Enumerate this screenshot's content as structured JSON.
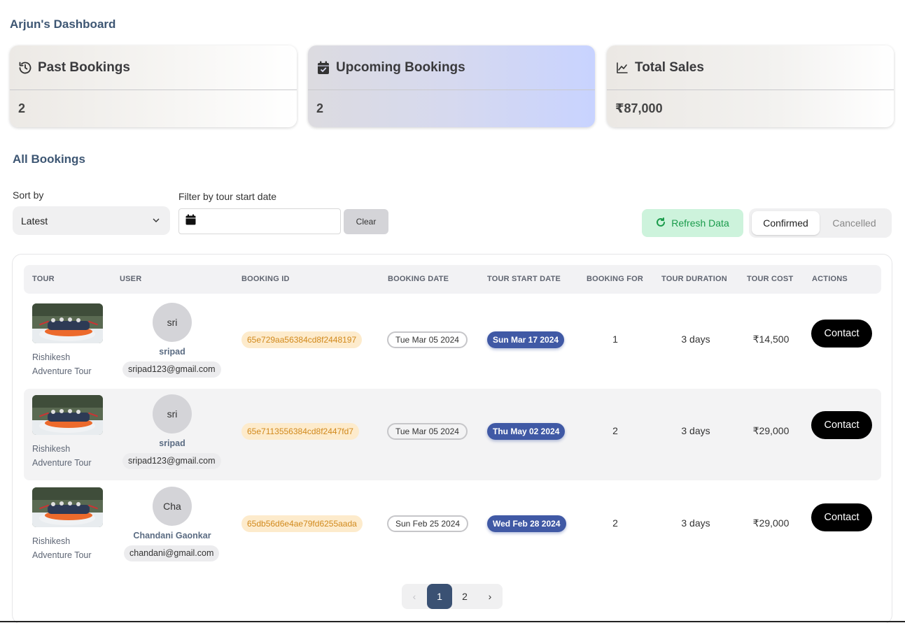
{
  "page_title": "Arjun's Dashboard",
  "stats": {
    "past": {
      "label": "Past Bookings",
      "value": "2",
      "icon": "history-icon"
    },
    "upcoming": {
      "label": "Upcoming Bookings",
      "value": "2",
      "icon": "calendar-check-icon"
    },
    "sales": {
      "label": "Total Sales",
      "value": "₹87,000",
      "icon": "trend-line-icon"
    }
  },
  "section_title": "All Bookings",
  "controls": {
    "sort_label": "Sort by",
    "sort_value": "Latest",
    "filter_label": "Filter by tour start date",
    "date_value": "",
    "clear_label": "Clear",
    "refresh_label": "Refresh Data",
    "tabs": [
      "Confirmed",
      "Cancelled"
    ],
    "active_tab": "Confirmed"
  },
  "table": {
    "headers": [
      "TOUR",
      "USER",
      "BOOKING ID",
      "BOOKING DATE",
      "TOUR START DATE",
      "BOOKING FOR",
      "TOUR DURATION",
      "TOUR COST",
      "ACTIONS"
    ],
    "rows": [
      {
        "tour_line1": "Rishikesh",
        "tour_line2": "Adventure Tour",
        "avatar": "sri",
        "user": "sripad",
        "email": "sripad123@gmail.com",
        "booking_id": "65e729aa56384cd8f2448197",
        "booking_date": "Tue Mar 05 2024",
        "start_date": "Sun Mar 17 2024",
        "booking_for": "1",
        "duration": "3 days",
        "cost": "₹14,500",
        "action": "Contact"
      },
      {
        "tour_line1": "Rishikesh",
        "tour_line2": "Adventure Tour",
        "avatar": "sri",
        "user": "sripad",
        "email": "sripad123@gmail.com",
        "booking_id": "65e7113556384cd8f2447fd7",
        "booking_date": "Tue Mar 05 2024",
        "start_date": "Thu May 02 2024",
        "booking_for": "2",
        "duration": "3 days",
        "cost": "₹29,000",
        "action": "Contact"
      },
      {
        "tour_line1": "Rishikesh",
        "tour_line2": "Adventure Tour",
        "avatar": "Cha",
        "user": "Chandani Gaonkar",
        "email": "chandani@gmail.com",
        "booking_id": "65db56d6e4ae79fd6255aada",
        "booking_date": "Sun Feb 25 2024",
        "start_date": "Wed Feb 28 2024",
        "booking_for": "2",
        "duration": "3 days",
        "cost": "₹29,000",
        "action": "Contact"
      }
    ]
  },
  "pagination": {
    "prev": "‹",
    "pages": [
      "1",
      "2"
    ],
    "current": "1",
    "next": "›"
  },
  "colors": {
    "title": "#3d5673",
    "accent_badge": "#4059a5",
    "refresh_green": "#1a9b4b",
    "booking_id_bg": "#fdebcc"
  }
}
